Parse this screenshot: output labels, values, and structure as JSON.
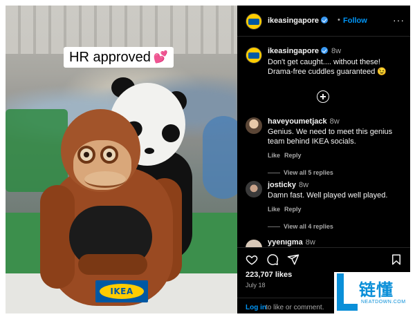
{
  "photo": {
    "sticker_text": "HR approved",
    "sticker_emoji": "💕",
    "logo_text": "IKEA"
  },
  "header": {
    "username": "ikeasingapore",
    "separator": "•",
    "follow_label": "Follow",
    "more_label": "···"
  },
  "caption": {
    "username": "ikeasingapore",
    "time": "8w",
    "text": "Don't get caught.... without these! Drama-free cuddles guaranteed 😉"
  },
  "comments": [
    {
      "username": "haveyoumetjack",
      "time": "8w",
      "text": "Genius. We need to meet this genius team behind IKEA socials.",
      "like_label": "Like",
      "reply_label": "Reply",
      "view_replies": "View all 5 replies"
    },
    {
      "username": "josticky",
      "time": "8w",
      "text": "Damn fast. Well played well played.",
      "like_label": "Like",
      "reply_label": "Reply",
      "view_replies": "View all 4 replies"
    },
    {
      "username": "yyenigma",
      "time": "8w"
    }
  ],
  "engagement": {
    "likes": "223,707 likes",
    "date": "July 18"
  },
  "login": {
    "link": "Log in",
    "text": "to like or comment."
  },
  "watermark": {
    "cn": "链懂",
    "en": "NEATDOWN.COM"
  },
  "colors": {
    "accent": "#0095f6",
    "ikea_blue": "#0058a3",
    "ikea_yellow": "#ffcc00"
  }
}
